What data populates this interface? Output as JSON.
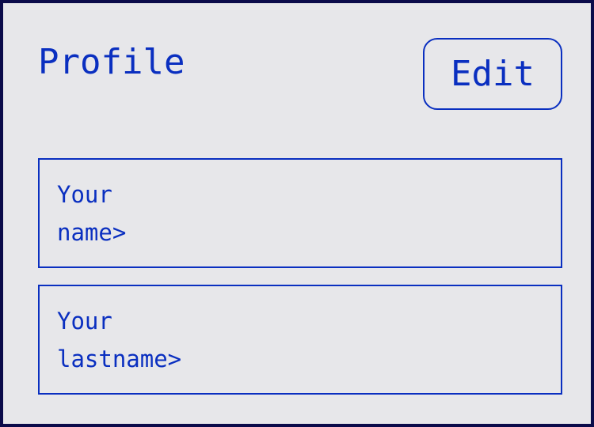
{
  "profile": {
    "title": "Profile",
    "edit_label": "Edit",
    "fields": [
      {
        "placeholder": "Your\nname>"
      },
      {
        "placeholder": "Your\nlastname>"
      }
    ]
  },
  "colors": {
    "accent": "#0a2fc0",
    "background": "#e7e7ea",
    "frame": "#0b0b4a"
  }
}
